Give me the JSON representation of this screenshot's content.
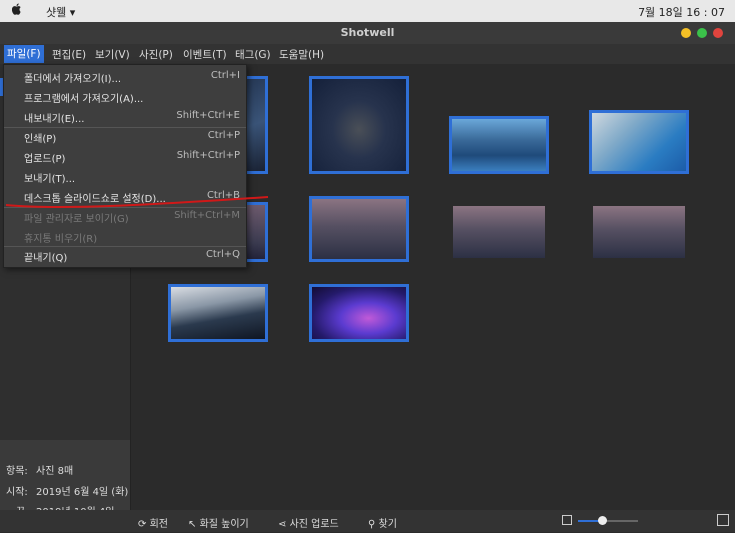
{
  "topbar": {
    "apple": "",
    "app_name": "샷웰 ▾",
    "clock": "7월 18일 16 : 07"
  },
  "window": {
    "title": "Shotwell"
  },
  "menubar": [
    {
      "label": "파일(F)"
    },
    {
      "label": "편집(E)"
    },
    {
      "label": "보기(V)"
    },
    {
      "label": "사진(P)"
    },
    {
      "label": "이벤트(T)"
    },
    {
      "label": "태그(G)"
    },
    {
      "label": "도움말(H)"
    }
  ],
  "file_menu": [
    {
      "label": "폴더에서 가져오기(I)...",
      "accel": "Ctrl+I",
      "enabled": true
    },
    {
      "label": "프로그램에서 가져오기(A)...",
      "accel": "",
      "enabled": true
    },
    {
      "label": "내보내기(E)...",
      "accel": "Shift+Ctrl+E",
      "enabled": true
    },
    {
      "label": "인쇄(P)",
      "accel": "Ctrl+P",
      "enabled": true
    },
    {
      "label": "업로드(P)",
      "accel": "Shift+Ctrl+P",
      "enabled": true
    },
    {
      "label": "보내기(T)...",
      "accel": "",
      "enabled": true
    },
    {
      "label": "데스크톱 슬라이드쇼로 설정(D)...",
      "accel": "Ctrl+B",
      "enabled": true
    },
    {
      "label": "파일 관리자로 보이기(G)",
      "accel": "Shift+Ctrl+M",
      "enabled": false
    },
    {
      "label": "휴지통 비우기(R)",
      "accel": "",
      "enabled": false
    },
    {
      "label": "끝내기(Q)",
      "accel": "Ctrl+Q",
      "enabled": true
    }
  ],
  "info": {
    "items_label": "항목:",
    "items_value": "사진 8매",
    "start_label": "시작:",
    "start_value": "2019년 6월 4일 (화)",
    "end_label": "끝:",
    "end_value": "2019년 10월 4일 (금)"
  },
  "bottombar": {
    "rotate": "회전",
    "enhance": "화질 높이기",
    "upload": "사진 업로드",
    "find": "찾기",
    "zoom_level": 0.4
  },
  "colors": {
    "accent": "#2f6fd6",
    "close": "#e0443e",
    "minimize": "#f5c026",
    "maximize": "#3bc14a"
  }
}
